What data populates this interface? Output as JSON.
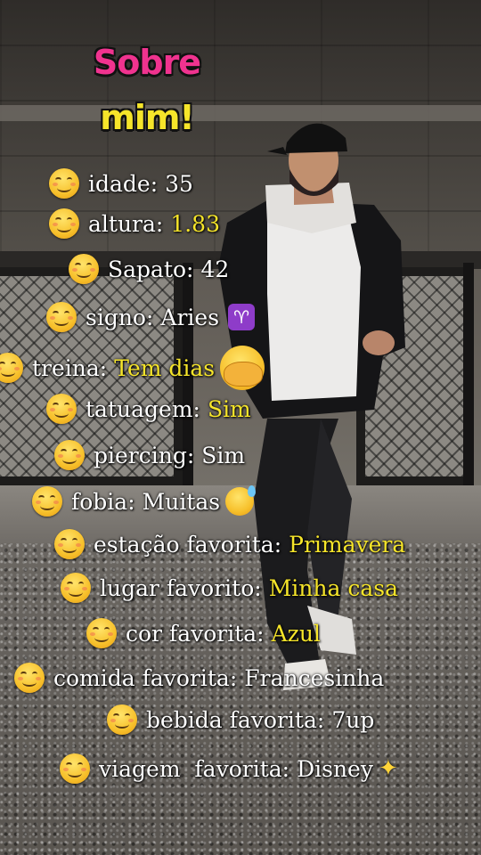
{
  "title": {
    "line1": "Sobre",
    "line2": "mim!"
  },
  "rows": [
    {
      "label": "idade:",
      "value": "35"
    },
    {
      "label": "altura:",
      "value": "1.83"
    },
    {
      "label": "Sapato:",
      "value": "42"
    },
    {
      "label": "signo:",
      "value": "Aries",
      "badge": "♈"
    },
    {
      "label": "treina:",
      "value": "Tem dias"
    },
    {
      "label": "tatuagem:",
      "value": "Sim"
    },
    {
      "label": "piercing:",
      "value": "Sim"
    },
    {
      "label": "fobia:",
      "value": "Muitas"
    },
    {
      "label": "estação favorita:",
      "value": "Primavera"
    },
    {
      "label": "lugar favorito:",
      "value": "Minha casa"
    },
    {
      "label": "cor favorita:",
      "value": "Azul"
    },
    {
      "label": "comida favorita:",
      "value": "Francesinha"
    },
    {
      "label": "bebida favorita:",
      "value": "7up"
    },
    {
      "label": "viagem  favorita:",
      "value": "Disney"
    }
  ],
  "icons": {
    "row_bullet": "smiling-face-emoji",
    "treina_extra": "face-with-hand-over-mouth-emoji",
    "fobia_extra": "grinning-sweat-emoji",
    "viagem_extra": "sparkles-emoji"
  },
  "colors": {
    "title_pink": "#f0338f",
    "highlight_yellow": "#f6e52a",
    "text": "#ffffff"
  }
}
